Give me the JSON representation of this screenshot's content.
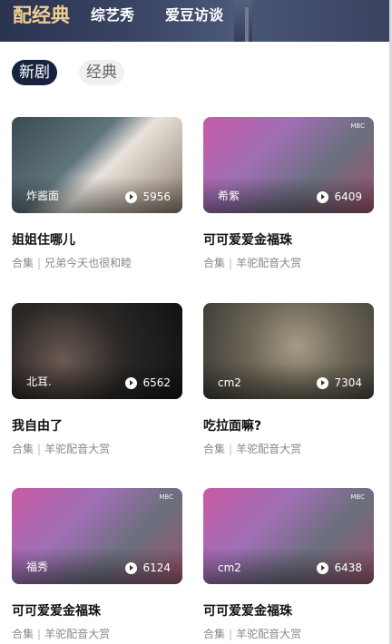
{
  "header": {
    "tabs": [
      "配经典",
      "综艺秀",
      "爱豆访谈"
    ]
  },
  "filters": [
    "新剧",
    "经典"
  ],
  "cards": [
    {
      "dubber": "炸酱面",
      "plays": "5956",
      "title": "姐姐住哪儿",
      "category": "合集",
      "series": "兄弟今天也很和睦",
      "badge": ""
    },
    {
      "dubber": "希紫",
      "plays": "6409",
      "title": "可可爱爱金福珠",
      "category": "合集",
      "series": "羊驼配音大赏",
      "badge": "MBC"
    },
    {
      "dubber": "北耳.",
      "plays": "6562",
      "title": "我自由了",
      "category": "合集",
      "series": "羊驼配音大赏",
      "badge": ""
    },
    {
      "dubber": "cm2",
      "plays": "7304",
      "title": "吃拉面嘛?",
      "category": "合集",
      "series": "羊驼配音大赏",
      "badge": ""
    },
    {
      "dubber": "福秀",
      "plays": "6124",
      "title": "可可爱爱金福珠",
      "category": "合集",
      "series": "羊驼配音大赏",
      "badge": "MBC"
    },
    {
      "dubber": "cm2",
      "plays": "6438",
      "title": "可可爱爱金福珠",
      "category": "合集",
      "series": "羊驼配音大赏",
      "badge": "MBC"
    }
  ],
  "colors": {
    "header_bg": "#2a3350",
    "active_tab": "#f1cf91",
    "chip_active": "#17233f"
  },
  "icons": {
    "play": "play-circle-icon"
  }
}
